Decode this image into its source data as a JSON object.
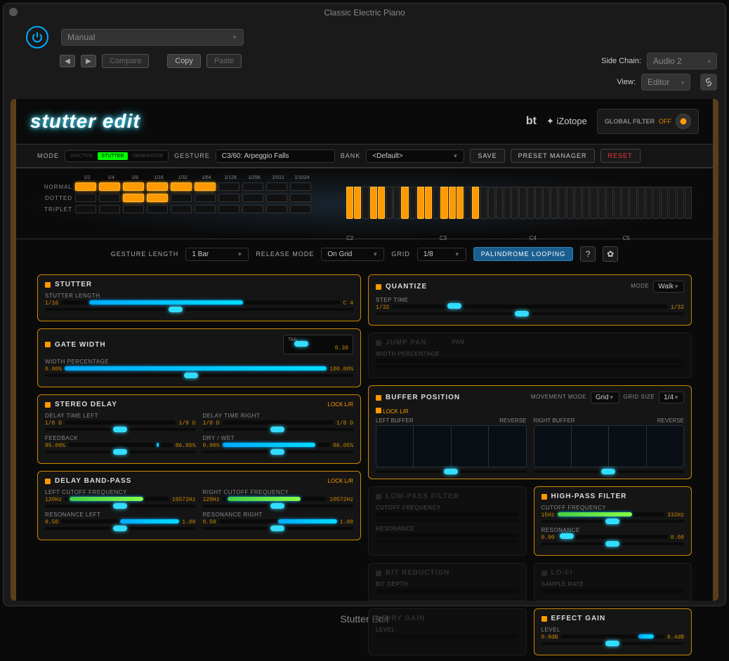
{
  "window": {
    "title": "Classic Electric Piano",
    "footer": "Stutter Edit"
  },
  "toolbar": {
    "preset": "Manual",
    "compare": "Compare",
    "copy": "Copy",
    "paste": "Paste",
    "sidechain_lbl": "Side Chain:",
    "sidechain_val": "Audio 2",
    "view_lbl": "View:",
    "view_val": "Editor"
  },
  "plugin": {
    "logo": "stutter edit",
    "brand1": "bt",
    "brand2": "iZotope",
    "gfilter_lbl": "GLOBAL FILTER",
    "gfilter_state": "OFF"
  },
  "top": {
    "mode_lbl": "MODE",
    "mode_inactive": "INACTIVE",
    "mode_stutter": "STUTTER",
    "mode_gen": "GENERATOR",
    "gesture_lbl": "GESTURE",
    "gesture_val": "C3/60: Arpeggio Falls",
    "bank_lbl": "BANK",
    "bank_val": "<Default>",
    "save": "SAVE",
    "preset_mgr": "PRESET MANAGER",
    "reset": "RESET"
  },
  "grid": {
    "cols": [
      "1/2",
      "1/4",
      "1/8",
      "1/16",
      "1/32",
      "1/64",
      "1/128",
      "1/256",
      "1/512",
      "1/1024"
    ],
    "rows": [
      "NORMAL",
      "DOTTED",
      "TRIPLET"
    ],
    "normal": [
      1,
      1,
      1,
      1,
      1,
      1,
      0,
      0,
      0,
      0
    ],
    "dotted": [
      0,
      0,
      1,
      1,
      0,
      0,
      0,
      0,
      0,
      0
    ],
    "triplet": [
      0,
      0,
      0,
      0,
      0,
      0,
      0,
      0,
      0,
      0
    ],
    "keylabels": [
      "C2",
      "C3",
      "C4",
      "C5"
    ]
  },
  "mid": {
    "glen_lbl": "GESTURE LENGTH",
    "glen_val": "1 Bar",
    "rmode_lbl": "RELEASE MODE",
    "rmode_val": "On Grid",
    "grid_lbl": "GRID",
    "grid_val": "1/8",
    "palin": "PALINDROME LOOPING"
  },
  "stutter": {
    "title": "STUTTER",
    "len_lbl": "STUTTER LENGTH",
    "lo": "1/16",
    "hi": "C 4"
  },
  "quantize": {
    "title": "QUANTIZE",
    "step_lbl": "STEP TIME",
    "mode_lbl": "MODE",
    "mode_val": "Walk",
    "lo": "1/32",
    "hi": "1/32"
  },
  "gate": {
    "title": "GATE WIDTH",
    "wp_lbl": "WIDTH PERCENTAGE",
    "lo": "0.00%",
    "hi": "100.00%",
    "tail_lbl": "TAIL",
    "tail_val": "0.30"
  },
  "jump": {
    "title": "JUMP PAN",
    "wp_lbl": "WIDTH PERCENTAGE",
    "pan_lbl": "PAN"
  },
  "buffer": {
    "title": "BUFFER POSITION",
    "lock": "LOCK L/R",
    "mm_lbl": "MOVEMENT MODE",
    "mm_val": "Grid",
    "gs_lbl": "GRID SIZE",
    "gs_val": "1/4",
    "left_lbl": "LEFT BUFFER",
    "right_lbl": "RIGHT BUFFER",
    "rev": "REVERSE"
  },
  "sdelay": {
    "title": "STEREO DELAY",
    "lock": "LOCK L/R",
    "dtl_lbl": "DELAY TIME LEFT",
    "dtl_lo": "1/8 D",
    "dtl_hi": "1/8 D",
    "dtr_lbl": "DELAY TIME RIGHT",
    "dtr_lo": "1/8 D",
    "dtr_hi": "1/8 D",
    "fb_lbl": "FEEDBACK",
    "fb_lo": "85.00%",
    "fb_hi": "86.05%",
    "dw_lbl": "DRY / WET",
    "dw_lo": "0.00%",
    "dw_hi": "86.05%"
  },
  "dbp": {
    "title": "DELAY BAND-PASS",
    "lock": "LOCK L/R",
    "lc_lbl": "LEFT CUTOFF FREQUENCY",
    "lc_lo": "120Hz",
    "lc_hi": "10572Hz",
    "rc_lbl": "RIGHT CUTOFF FREQUENCY",
    "rc_lo": "120Hz",
    "rc_hi": "10572Hz",
    "rl_lbl": "RESONANCE LEFT",
    "rl_lo": "0.50",
    "rl_hi": "1.00",
    "rr_lbl": "RESONANCE RIGHT",
    "rr_lo": "0.50",
    "rr_hi": "1.00"
  },
  "lpf": {
    "title": "LOW-PASS FILTER",
    "cf_lbl": "CUTOFF FREQUENCY",
    "res_lbl": "RESONANCE"
  },
  "hpf": {
    "title": "HIGH-PASS FILTER",
    "cf_lbl": "CUTOFF FREQUENCY",
    "cf_lo": "15Hz",
    "cf_hi": "332Hz",
    "res_lbl": "RESONANCE",
    "res_lo": "0.00",
    "res_hi": "0.00"
  },
  "bitr": {
    "title": "BIT REDUCTION",
    "bd_lbl": "BIT DEPTH"
  },
  "lofi": {
    "title": "LO-FI",
    "sr_lbl": "SAMPLE RATE"
  },
  "dgain": {
    "title": "DRY GAIN",
    "lvl_lbl": "LEVEL"
  },
  "egain": {
    "title": "EFFECT GAIN",
    "lvl_lbl": "LEVEL",
    "lo": "0.0dB",
    "hi": "6.4dB"
  }
}
